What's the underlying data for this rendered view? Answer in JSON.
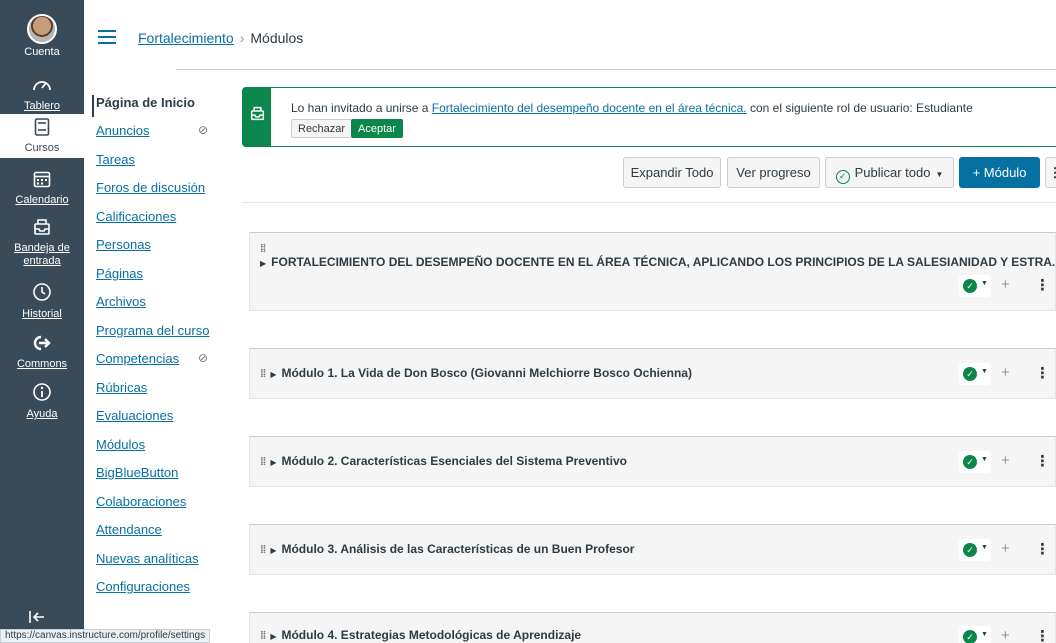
{
  "global_nav": {
    "account": "Cuenta",
    "dashboard": "Tablero",
    "courses": "Cursos",
    "calendar": "Calendario",
    "inbox_line1": "Bandeja de",
    "inbox_line2": "entrada",
    "history": "Historial",
    "commons": "Commons",
    "help": "Ayuda"
  },
  "breadcrumb": {
    "course": "Fortalecimiento",
    "separator": "›",
    "current": "Módulos"
  },
  "course_nav": {
    "items": [
      "Página de Inicio",
      "Anuncios",
      "Tareas",
      "Foros de discusión",
      "Calificaciones",
      "Personas",
      "Páginas",
      "Archivos",
      "Programa del curso",
      "Competencias",
      "Rúbricas",
      "Evaluaciones",
      "Módulos",
      "BigBlueButton",
      "Colaboraciones",
      "Attendance",
      "Nuevas analíticas",
      "Configuraciones"
    ],
    "active_index": 0
  },
  "invitation": {
    "prefix": "Lo han invitado a unirse a ",
    "course_link": "Fortalecimiento del desempeño docente en el área técnica.",
    "suffix": " con el siguiente rol de usuario: Estudiante",
    "reject": "Rechazar",
    "accept": "Aceptar"
  },
  "toolbar": {
    "expand_all": "Expandir Todo",
    "view_progress": "Ver progreso",
    "publish_all": "Publicar todo",
    "add_module": "+ Módulo"
  },
  "modules": [
    "FORTALECIMIENTO DEL DESEMPEÑO DOCENTE EN EL ÁREA TÉCNICA, APLICANDO LOS PRINCIPIOS DE LA SALESIANIDAD Y ESTRA...",
    "Módulo 1. La Vida de Don Bosco (Giovanni Melchiorre Bosco Ochienna)",
    "Módulo 2. Características Esenciales del Sistema Preventivo",
    "Módulo 3. Análisis de las Características de un Buen Profesor",
    "Módulo 4. Estrategias Metodológicas de Aprendizaje"
  ],
  "status_bar_url": "https://canvas.instructure.com/profile/settings",
  "colors": {
    "nav_bg": "#394b58",
    "link": "#0770a3",
    "success": "#0b874b"
  }
}
